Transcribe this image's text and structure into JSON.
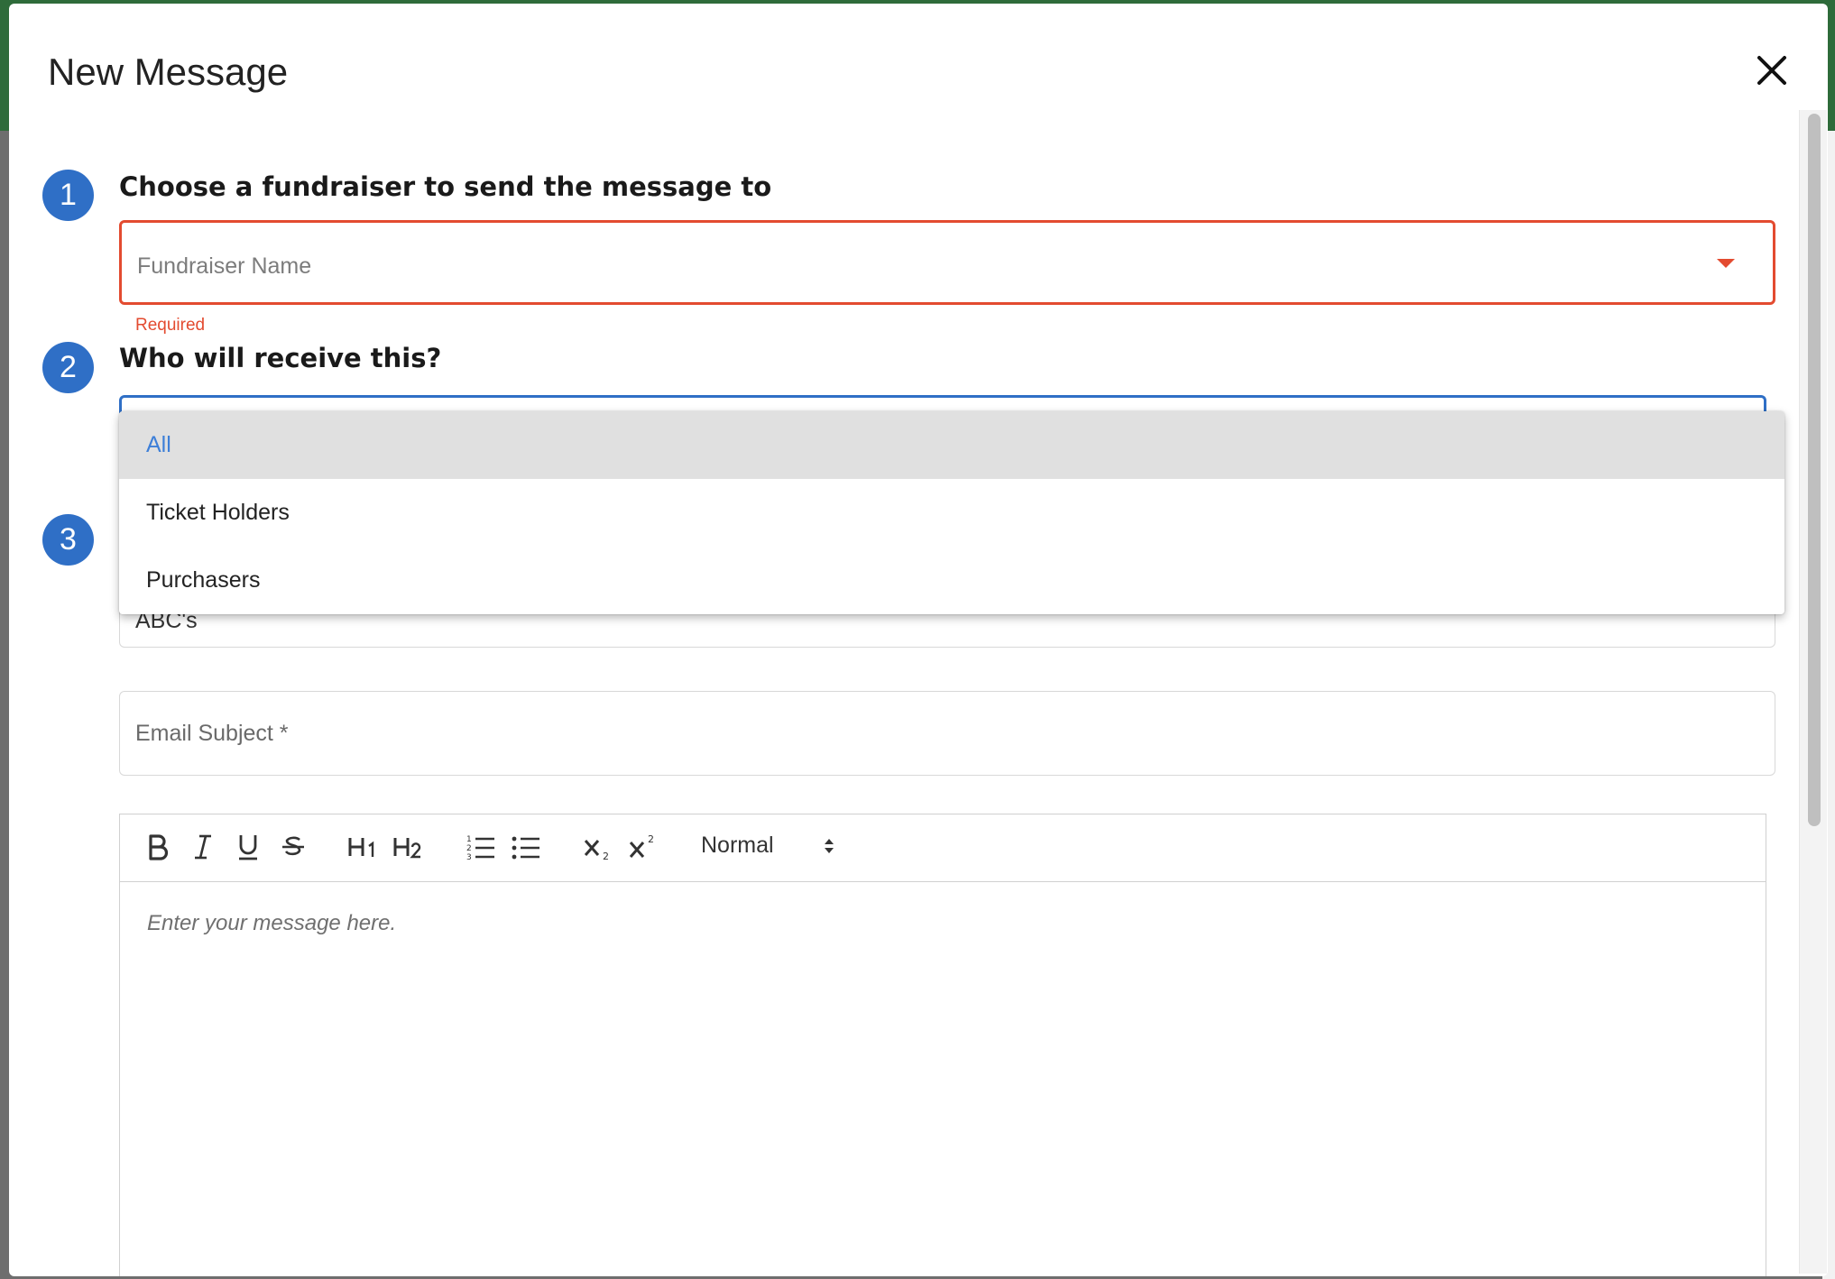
{
  "modal": {
    "title": "New Message"
  },
  "steps": [
    {
      "number": "1",
      "title": "Choose a fundraiser to send the message to"
    },
    {
      "number": "2",
      "title": "Who will receive this?"
    },
    {
      "number": "3"
    }
  ],
  "fundraiser_field": {
    "placeholder": "Fundraiser Name",
    "error": "Required"
  },
  "recipient_dropdown": {
    "options": [
      "All",
      "Ticket Holders",
      "Purchasers"
    ],
    "selected": "All"
  },
  "step3_field": {
    "partial_value": "ABC's"
  },
  "email_subject": {
    "placeholder": "Email Subject *"
  },
  "editor": {
    "format": "Normal",
    "placeholder": "Enter your message here."
  },
  "colors": {
    "accent_blue": "#2f6fc6",
    "error_red": "#e34b30"
  }
}
